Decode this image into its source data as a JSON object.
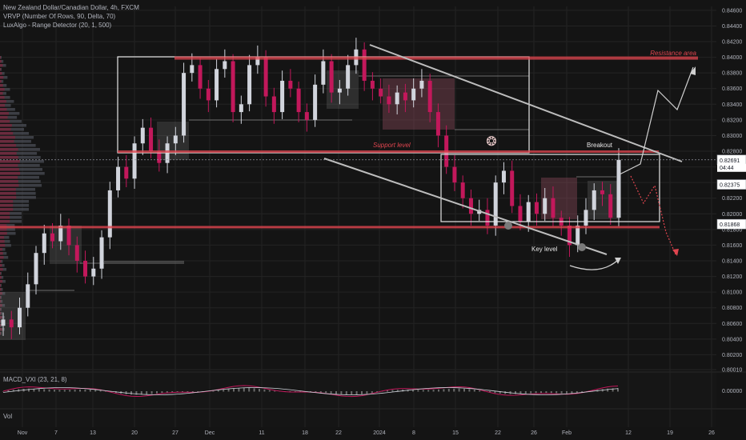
{
  "header": {
    "symbol_line": "New Zealand Dollar/Canadian Dollar, 4h, FXCM",
    "indicator1": "VRVP (Number Of Rows, 90, Delta, 70)",
    "indicator2": "LuxAlgo - Range Detector (20, 1, 500)"
  },
  "macd_label": "MACD_VXI (23, 21, 8)",
  "vol_label": "Vol",
  "colors": {
    "bull": "#d1d4dc",
    "bear": "#c2185b",
    "accent": "#e0454f",
    "grid": "#232323",
    "text": "#b2b5be"
  },
  "annotations": {
    "resistance": "Resistance area",
    "support": "Support level",
    "breakout": "Breakout",
    "key_level": "Key level"
  },
  "price_badges": {
    "current": "0.82691",
    "countdown": "04:44",
    "level2": "0.82375",
    "level3": "0.81868",
    "macd_zero": "0.00000"
  },
  "chart_data": {
    "type": "candlestick",
    "y_ticks": [
      "0.84600",
      "0.84400",
      "0.84200",
      "0.84000",
      "0.83800",
      "0.83600",
      "0.83400",
      "0.83200",
      "0.83000",
      "0.82800",
      "0.82600",
      "0.82400",
      "0.82200",
      "0.82000",
      "0.81800",
      "0.81600",
      "0.81400",
      "0.81200",
      "0.81000",
      "0.80800",
      "0.80600",
      "0.80400",
      "0.80200",
      "0.80010"
    ],
    "x_ticks": [
      "Nov",
      "7",
      "13",
      "20",
      "27",
      "Dec",
      "11",
      "18",
      "22",
      "2024",
      "8",
      "15",
      "22",
      "26",
      "Feb",
      "12",
      "19",
      "26"
    ],
    "ylim": [
      0.8001,
      0.8465
    ],
    "resistance_level": 0.8399,
    "support_level": 0.8183,
    "close_series": [
      0.8065,
      0.8055,
      0.808,
      0.811,
      0.815,
      0.8175,
      0.8165,
      0.8185,
      0.816,
      0.814,
      0.812,
      0.813,
      0.817,
      0.823,
      0.826,
      0.8245,
      0.829,
      0.831,
      0.828,
      0.8265,
      0.829,
      0.83,
      0.838,
      0.839,
      0.836,
      0.8345,
      0.8385,
      0.8395,
      0.833,
      0.834,
      0.839,
      0.84,
      0.835,
      0.833,
      0.837,
      0.836,
      0.833,
      0.832,
      0.8365,
      0.8395,
      0.8355,
      0.836,
      0.839,
      0.841,
      0.837,
      0.836,
      0.835,
      0.834,
      0.8355,
      0.8345,
      0.836,
      0.837,
      0.833,
      0.83,
      0.826,
      0.824,
      0.822,
      0.82,
      0.8205,
      0.8185,
      0.824,
      0.8255,
      0.821,
      0.819,
      0.8215,
      0.82,
      0.822,
      0.8195,
      0.8185,
      0.816,
      0.8185,
      0.8205,
      0.823,
      0.8225,
      0.8195,
      0.8269
    ]
  }
}
